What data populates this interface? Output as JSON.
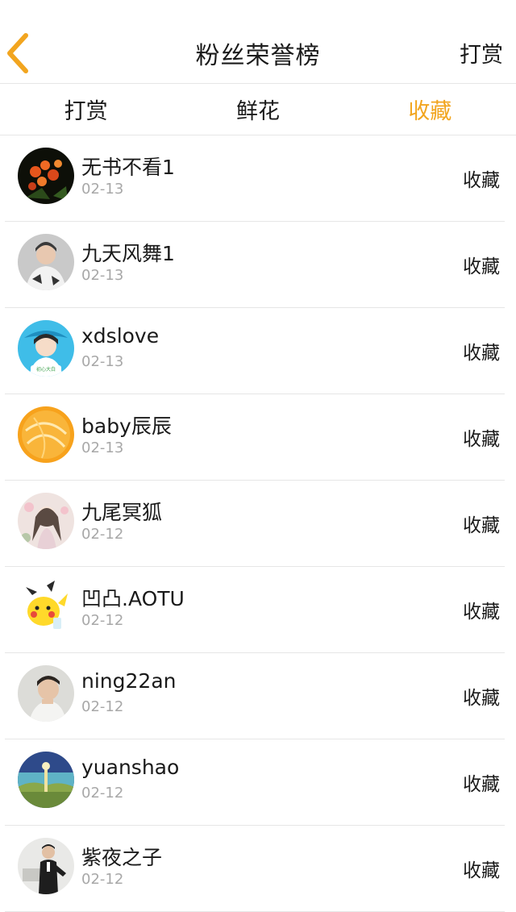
{
  "header": {
    "title": "粉丝荣誉榜",
    "right_action": "打赏",
    "back_icon": "chevron-left-icon",
    "back_color": "#f2a51f"
  },
  "tabs": [
    {
      "label": "打赏",
      "active": false
    },
    {
      "label": "鲜花",
      "active": false
    },
    {
      "label": "收藏",
      "active": true
    }
  ],
  "accent_color": "#f2a51f",
  "list": [
    {
      "name": "无书不看1",
      "date": "02-13",
      "action": "收藏",
      "avatar": "flower-avatar"
    },
    {
      "name": "九天风舞1",
      "date": "02-13",
      "action": "收藏",
      "avatar": "person-avatar"
    },
    {
      "name": "xdslove",
      "date": "02-13",
      "action": "收藏",
      "avatar": "girl-avatar"
    },
    {
      "name": "baby辰辰",
      "date": "02-13",
      "action": "收藏",
      "avatar": "orange-avatar"
    },
    {
      "name": "九尾冥狐",
      "date": "02-12",
      "action": "收藏",
      "avatar": "anime-girl-avatar"
    },
    {
      "name": "凹凸.AOTU",
      "date": "02-12",
      "action": "收藏",
      "avatar": "pikachu-avatar"
    },
    {
      "name": "ning22an",
      "date": "02-12",
      "action": "收藏",
      "avatar": "boy-avatar"
    },
    {
      "name": "yuanshao",
      "date": "02-12",
      "action": "收藏",
      "avatar": "landscape-avatar"
    },
    {
      "name": "紫夜之子",
      "date": "02-12",
      "action": "收藏",
      "avatar": "man-in-suit-avatar"
    }
  ]
}
